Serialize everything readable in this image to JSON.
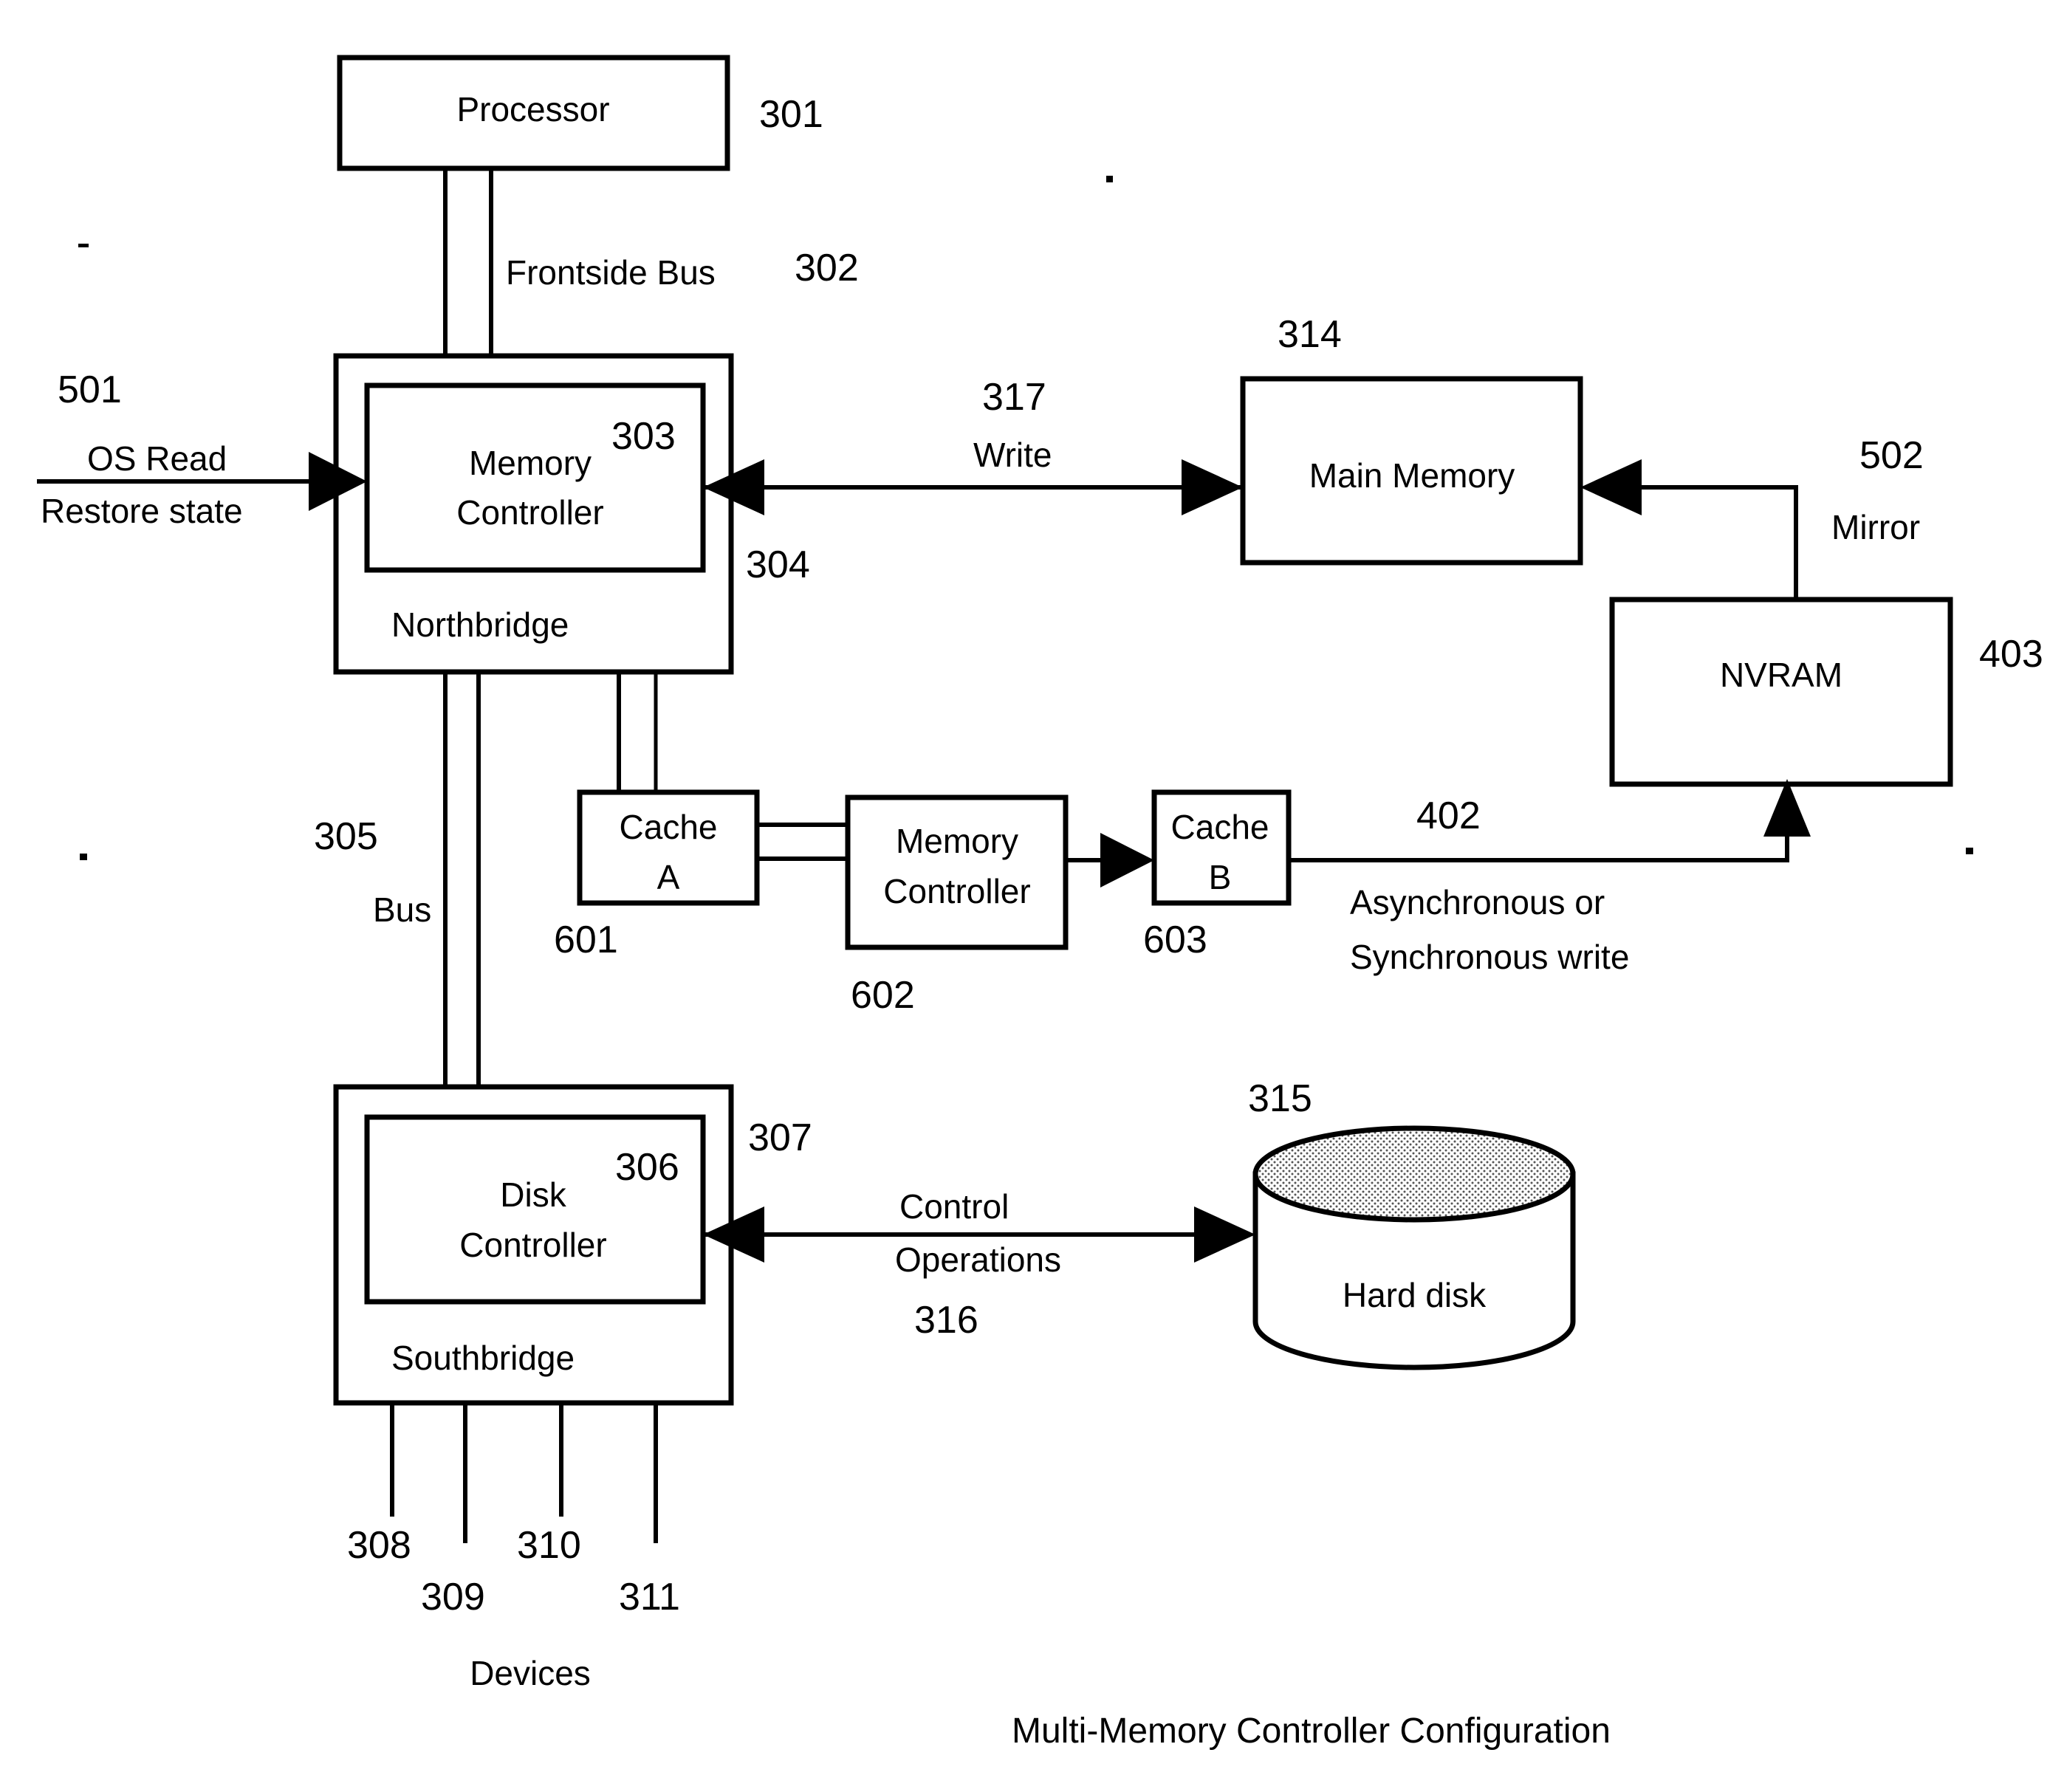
{
  "diagram": {
    "caption": "Multi-Memory Controller Configuration",
    "blocks": {
      "processor": {
        "label": "Processor",
        "ref": "301"
      },
      "frontside_bus": {
        "label": "Frontside Bus",
        "ref": "302"
      },
      "memory_controller_north": {
        "label_line1": "Memory",
        "label_line2": "Controller",
        "ref": "303"
      },
      "northbridge": {
        "label": "Northbridge",
        "ref": "304"
      },
      "bus": {
        "label": "Bus",
        "ref": "305"
      },
      "disk_controller": {
        "label_line1": "Disk",
        "label_line2": "Controller",
        "ref": "306"
      },
      "southbridge": {
        "label": "Southbridge",
        "ref": "307"
      },
      "main_memory": {
        "label": "Main Memory",
        "ref": "314"
      },
      "hard_disk": {
        "label": "Hard disk",
        "ref": "315"
      },
      "nvram": {
        "label": "NVRAM",
        "ref": "403"
      },
      "cache_a": {
        "label_line1": "Cache",
        "label_line2": "A",
        "ref": "601"
      },
      "memory_controller_mid": {
        "label_line1": "Memory",
        "label_line2": "Controller",
        "ref": "602"
      },
      "cache_b": {
        "label_line1": "Cache",
        "label_line2": "B",
        "ref": "603"
      }
    },
    "connections": {
      "os_read": {
        "ref": "501",
        "label_line1": "OS Read",
        "label_line2": "Restore state"
      },
      "write": {
        "ref": "317",
        "label": "Write"
      },
      "mirror": {
        "ref": "502",
        "label": "Mirror"
      },
      "async_sync_write": {
        "ref": "402",
        "label_line1": "Asynchronous or",
        "label_line2": "Synchronous write"
      },
      "control_operations": {
        "ref": "316",
        "label_line1": "Control",
        "label_line2": "Operations"
      }
    },
    "devices": {
      "label": "Devices",
      "refs": [
        "308",
        "309",
        "310",
        "311"
      ]
    }
  }
}
